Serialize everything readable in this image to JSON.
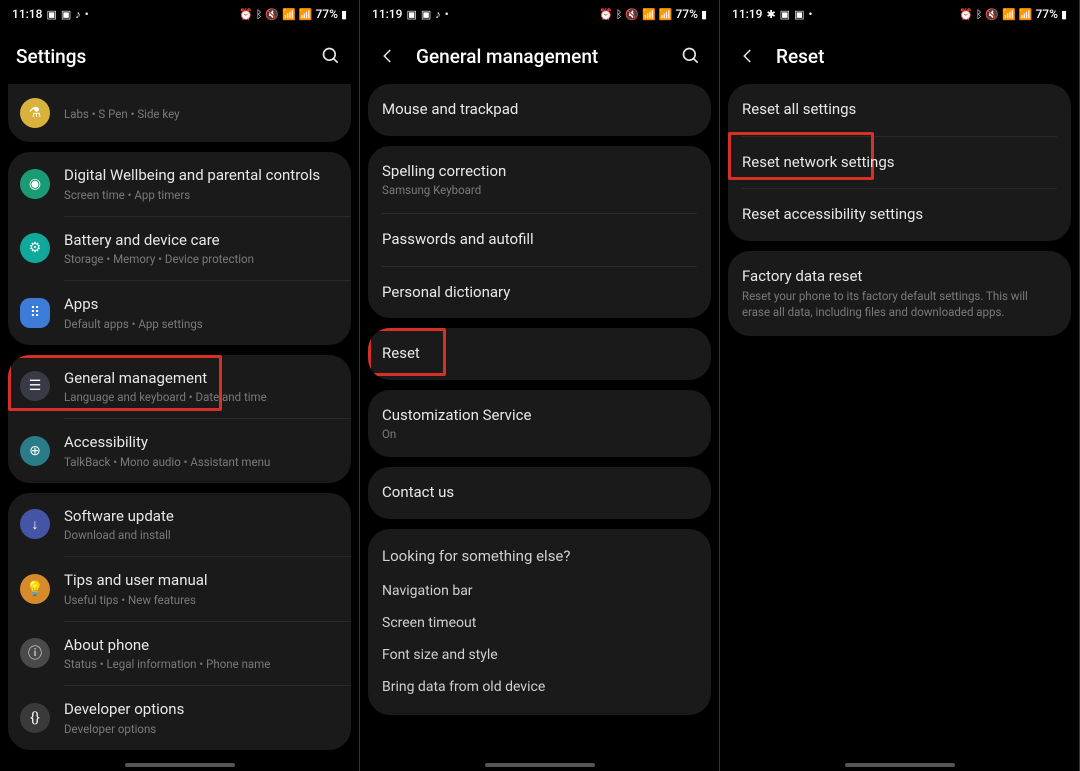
{
  "status": {
    "time1": "11:18",
    "time2": "11:19",
    "time3": "11:19",
    "battery": "77%"
  },
  "screen1": {
    "title": "Settings",
    "items": [
      {
        "title": "",
        "sub": "Labs  •  S Pen  •  Side key"
      },
      {
        "title": "Digital Wellbeing and parental controls",
        "sub": "Screen time  •  App timers"
      },
      {
        "title": "Battery and device care",
        "sub": "Storage  •  Memory  •  Device protection"
      },
      {
        "title": "Apps",
        "sub": "Default apps  •  App settings"
      },
      {
        "title": "General management",
        "sub": "Language and keyboard  •  Date and time"
      },
      {
        "title": "Accessibility",
        "sub": "TalkBack  •  Mono audio  •  Assistant menu"
      },
      {
        "title": "Software update",
        "sub": "Download and install"
      },
      {
        "title": "Tips and user manual",
        "sub": "Useful tips  •  New features"
      },
      {
        "title": "About phone",
        "sub": "Status  •  Legal information  •  Phone name"
      },
      {
        "title": "Developer options",
        "sub": "Developer options"
      }
    ]
  },
  "screen2": {
    "title": "General management",
    "items": [
      {
        "title": "Mouse and trackpad"
      },
      {
        "title": "Spelling correction",
        "sub": "Samsung Keyboard"
      },
      {
        "title": "Passwords and autofill"
      },
      {
        "title": "Personal dictionary"
      },
      {
        "title": "Reset"
      },
      {
        "title": "Customization Service",
        "sub": "On"
      },
      {
        "title": "Contact us"
      }
    ],
    "lookingHeader": "Looking for something else?",
    "links": [
      "Navigation bar",
      "Screen timeout",
      "Font size and style",
      "Bring data from old device"
    ]
  },
  "screen3": {
    "title": "Reset",
    "items": [
      {
        "title": "Reset all settings"
      },
      {
        "title": "Reset network settings"
      },
      {
        "title": "Reset accessibility settings"
      },
      {
        "title": "Factory data reset",
        "sub": "Reset your phone to its factory default settings. This will erase all data, including files and downloaded apps."
      }
    ]
  }
}
